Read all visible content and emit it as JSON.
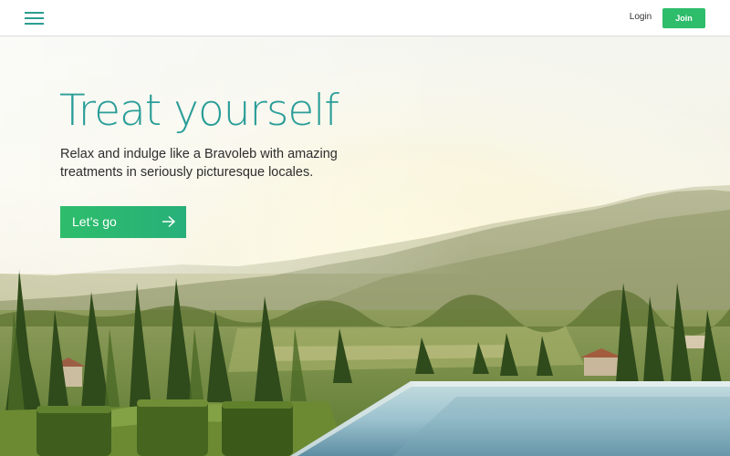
{
  "header": {
    "menu_icon": "hamburger-menu-icon",
    "login_label": "Login",
    "join_label": "Join"
  },
  "hero": {
    "title": "Treat yourself",
    "subtitle": "Relax and indulge like a Bravoleb with amazing treatments in seriously picturesque locales.",
    "cta_label": "Let’s go",
    "cta_icon": "arrow-right-icon",
    "image": "mountain-landscape-infinity-pool-photo"
  },
  "colors": {
    "accent_teal": "#2a9d98",
    "brand_green": "#2ebd6b",
    "text_dark": "#2d2d2d"
  }
}
